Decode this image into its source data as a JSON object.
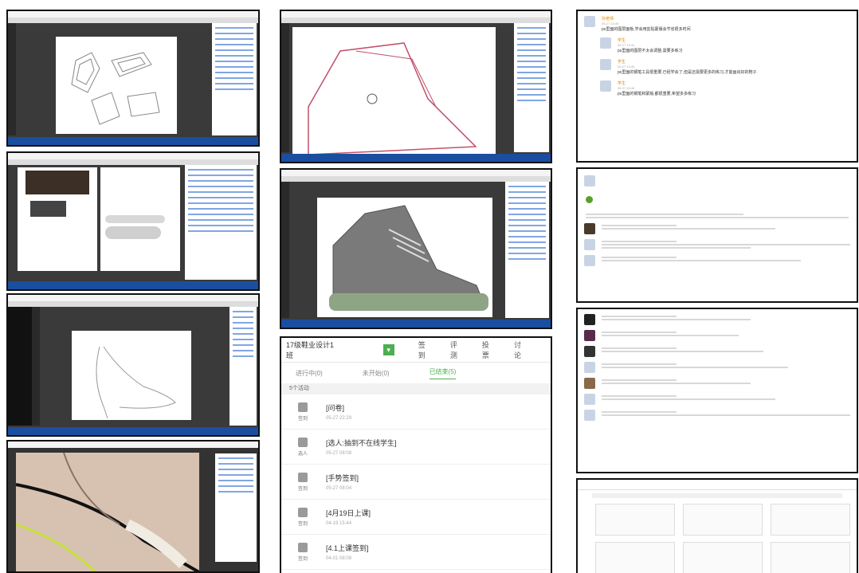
{
  "mobile": {
    "header_title": "17级鞋业设计1班",
    "header_actions": [
      "签到",
      "评测",
      "投票",
      "讨论"
    ],
    "tabs": [
      "进行中(0)",
      "未开始(0)",
      "已结束(5)"
    ],
    "active_tab_index": 2,
    "section_label": "5个活动",
    "items": [
      {
        "icon": "signin-icon",
        "type": "签到",
        "title": "[问卷]",
        "date": "05-27 22:29"
      },
      {
        "icon": "person-icon",
        "type": "选人",
        "title": "[选人:抽到不在线学生]",
        "date": "05-27 08:08"
      },
      {
        "icon": "hand-icon",
        "type": "签到",
        "title": "[手势签到]",
        "date": "05-27 08:04"
      },
      {
        "icon": "hand-icon",
        "type": "签到",
        "title": "[4月19日上课]",
        "date": "04-19 15:44"
      },
      {
        "icon": "hand-icon",
        "type": "签到",
        "title": "[4.1上课签到]",
        "date": "04-01 08:08"
      }
    ]
  },
  "comments_top": {
    "entries": [
      {
        "name": "孙老师",
        "date": "05-27 10:30",
        "text": "ps里面的图层面板,学会用剪贴蒙版会节省很多时间"
      },
      {
        "name": "学生",
        "date": "05-27 10:44",
        "text": "ps里面的图层不太会调整,需要多练习"
      },
      {
        "name": "学生",
        "date": "05-27 10:45",
        "text": "ps里面的钢笔工具很重要,已经学会了,但是还需要更多的练习,才能画出好的鞋子"
      },
      {
        "name": "学生",
        "date": "05-27 10:46",
        "text": "ps里面的钢笔和蒙版,都很重要,希望多多练习"
      }
    ]
  }
}
